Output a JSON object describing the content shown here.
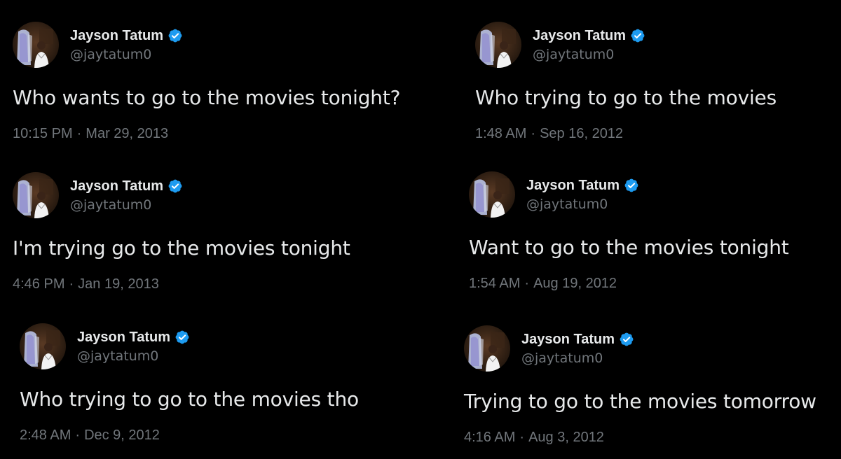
{
  "tweets": [
    {
      "display_name": "Jayson Tatum",
      "handle": "@jaytatum0",
      "text": "Who wants to go to the movies tonight?",
      "time": "10:15 PM",
      "separator": "·",
      "date": "Mar 29, 2013"
    },
    {
      "display_name": "Jayson Tatum",
      "handle": "@jaytatum0",
      "text": "I'm trying go to the movies tonight",
      "time": "4:46 PM",
      "separator": "·",
      "date": "Jan 19, 2013"
    },
    {
      "display_name": "Jayson Tatum",
      "handle": "@jaytatum0",
      "text": "Who trying to go to the movies tho",
      "time": "2:48 AM",
      "separator": "·",
      "date": "Dec 9, 2012"
    },
    {
      "display_name": "Jayson Tatum",
      "handle": "@jaytatum0",
      "text": "Who trying to go to the movies",
      "time": "1:48 AM",
      "separator": "·",
      "date": "Sep 16, 2012"
    },
    {
      "display_name": "Jayson Tatum",
      "handle": "@jaytatum0",
      "text": "Want to go to the movies tonight",
      "time": "1:54 AM",
      "separator": "·",
      "date": "Aug 19, 2012"
    },
    {
      "display_name": "Jayson Tatum",
      "handle": "@jaytatum0",
      "text": "Trying to go to the movies tomorrow",
      "time": "4:16 AM",
      "separator": "·",
      "date": "Aug 3, 2012"
    }
  ],
  "colors": {
    "background": "#000000",
    "primary_text": "#e7e9ea",
    "secondary_text": "#71767b",
    "verified_blue": "#1d9bf0"
  },
  "icons": {
    "verified": "verified-badge-icon",
    "avatar": "profile-avatar"
  }
}
